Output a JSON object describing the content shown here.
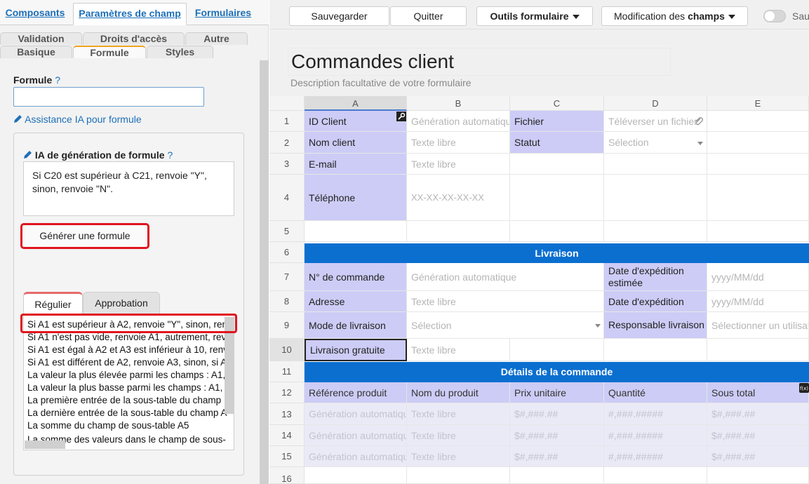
{
  "left_panel": {
    "top_tabs": [
      "Composants",
      "Paramètres de champ",
      "Formulaires"
    ],
    "sub_tabs_row1": [
      "Validation",
      "Droits d'accès",
      "Autre"
    ],
    "sub_tabs_row2": [
      "Basique",
      "Formule",
      "Styles"
    ],
    "formula_label": "Formule",
    "help": "?",
    "formula_value": "",
    "ia_link": "Assistance IA pour formule",
    "ai_title": "IA de génération de formule",
    "ai_prompt": "Si C20 est supérieur à C21, renvoie \"Y\", sinon, renvoie \"N\".",
    "generate_button": "Générer une formule",
    "list_tabs": [
      "Régulier",
      "Approbation"
    ],
    "examples": [
      "Si A1 est supérieur à A2, renvoie \"Y\", sinon, ren",
      "Si A1 n'est pas vide, renvoie A1, autrement, rev",
      "Si A1 est égal à A2 et A3 est inférieur à 10, renv",
      "Si A1 est différent de A2, renvoie A3, sinon, si A",
      "La valeur la plus élevée parmi les champs : A1,",
      "La valeur la plus basse parmi les champs : A1, A",
      "La première entrée de la sous-table du champ",
      "La dernière entrée de la sous-table du champ A",
      "La somme du champ de sous-table A5",
      "La somme des valeurs dans le champ de sous-"
    ]
  },
  "toolbar": {
    "save": "Sauvegarder",
    "quit": "Quitter",
    "tools": "Outils formulaire",
    "modif_prefix": "Modification des ",
    "modif_bold": "champs",
    "toggle_label": "Sau"
  },
  "form": {
    "title": "Commandes client",
    "description": "Description facultative de votre formulaire"
  },
  "grid": {
    "columns": [
      "A",
      "B",
      "C",
      "D",
      "E"
    ],
    "rows": [
      "1",
      "2",
      "3",
      "4",
      "5",
      "6",
      "7",
      "8",
      "9",
      "10",
      "11",
      "12",
      "13",
      "14",
      "15",
      "16"
    ],
    "r1": {
      "a": "ID Client",
      "b": "Génération automatique",
      "c": "Fichier",
      "d": "Téléverser un fichier"
    },
    "r2": {
      "a": "Nom client",
      "b": "Texte libre",
      "c": "Statut",
      "d": "Sélection"
    },
    "r3": {
      "a": "E-mail",
      "b": "Texte libre"
    },
    "r4": {
      "a": "Téléphone",
      "b": "XX-XX-XX-XX-XX"
    },
    "section_livraison": "Livraison",
    "r7": {
      "a": "N° de commande",
      "b": "Génération automatique",
      "d": "Date d'expédition estimée",
      "e": "yyyy/MM/dd"
    },
    "r8": {
      "a": "Adresse",
      "b": "Texte libre",
      "d": "Date d'expédition",
      "e": "yyyy/MM/dd"
    },
    "r9": {
      "a": "Mode de livraison",
      "b": "Sélection",
      "d": "Responsable livraison",
      "e": "Sélectionner un utilisateur"
    },
    "r10": {
      "a": "Livraison gratuite",
      "b": "Texte libre"
    },
    "section_details": "Détails de la commande",
    "r12": {
      "a": "Référence produit",
      "b": "Nom du produit",
      "c": "Prix unitaire",
      "d": "Quantité",
      "e": "Sous total"
    },
    "sub_placeholders": {
      "a": "Génération automatique",
      "b": "Texte libre",
      "c": "$#,###.##",
      "d": "#,###.#####",
      "e": "$#,###.##"
    }
  },
  "colors": {
    "accent": "#0b6fd0",
    "label_bg": "#ccccf6",
    "highlight": "#e0151e"
  }
}
